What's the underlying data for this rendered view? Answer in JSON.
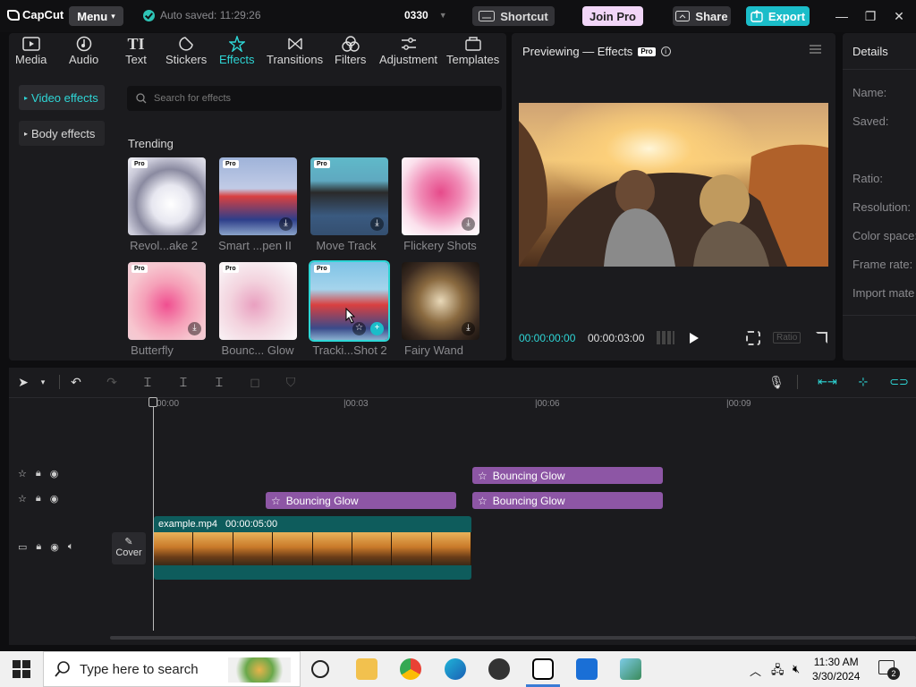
{
  "app": {
    "logo_text": "CapCut",
    "menu_label": "Menu",
    "autosave_text": "Auto saved: 11:29:26",
    "project_name": "0330"
  },
  "titlebar": {
    "shortcut_label": "Shortcut",
    "joinpro_label": "Join Pro",
    "share_label": "Share",
    "export_label": "Export"
  },
  "tabs": [
    {
      "label": "Media",
      "icon": "media-icon"
    },
    {
      "label": "Audio",
      "icon": "audio-icon"
    },
    {
      "label": "Text",
      "icon": "text-icon"
    },
    {
      "label": "Stickers",
      "icon": "stickers-icon"
    },
    {
      "label": "Effects",
      "icon": "effects-icon",
      "active": true
    },
    {
      "label": "Transitions",
      "icon": "transitions-icon"
    },
    {
      "label": "Filters",
      "icon": "filters-icon"
    },
    {
      "label": "Adjustment",
      "icon": "adjustment-icon"
    },
    {
      "label": "Templates",
      "icon": "templates-icon"
    }
  ],
  "sidebar": {
    "video_effects": "Video effects",
    "body_effects": "Body effects"
  },
  "search": {
    "placeholder": "Search for effects"
  },
  "section": {
    "trending": "Trending"
  },
  "effects": [
    {
      "label": "Revol...ake 2",
      "pro": true,
      "pro_label": "Pro"
    },
    {
      "label": "Smart ...pen II",
      "pro": true,
      "pro_label": "Pro"
    },
    {
      "label": "Move Track",
      "pro": true,
      "pro_label": "Pro"
    },
    {
      "label": "Flickery Shots",
      "pro": false
    },
    {
      "label": "Butterfly",
      "pro": true,
      "pro_label": "Pro"
    },
    {
      "label": "Bounc... Glow",
      "pro": true,
      "pro_label": "Pro"
    },
    {
      "label": "Tracki...Shot 2",
      "pro": true,
      "pro_label": "Pro"
    },
    {
      "label": "Fairy Wand",
      "pro": false
    }
  ],
  "preview": {
    "title": "Previewing — Effects",
    "pro_tag": "Pro",
    "time_current": "00:00:00:00",
    "time_total": "00:00:03:00",
    "ratio_label": "Ratio"
  },
  "details": {
    "title": "Details",
    "rows": [
      "Name:",
      "Saved:",
      "Ratio:",
      "Resolution:",
      "Color space:",
      "Frame rate:",
      "Import mate"
    ]
  },
  "timeline": {
    "ticks": [
      "00:00",
      "|00:03",
      "|00:06",
      "|00:09"
    ],
    "fx_clips": [
      {
        "label": "Bouncing Glow"
      },
      {
        "label": "Bouncing Glow"
      },
      {
        "label": "Bouncing Glow"
      }
    ],
    "video_clip": {
      "name": "example.mp4",
      "duration": "00:00:05:00"
    },
    "cover_label": "Cover"
  },
  "taskbar": {
    "search_placeholder": "Type here to search",
    "time": "11:30 AM",
    "date": "3/30/2024",
    "notif_count": "2"
  },
  "colors": {
    "accent": "#2ed6d6",
    "export": "#1bbdc9",
    "fx_clip": "#8d56a5",
    "video_clip": "#0e5c5c",
    "joinpro": "#f2d6f8"
  }
}
